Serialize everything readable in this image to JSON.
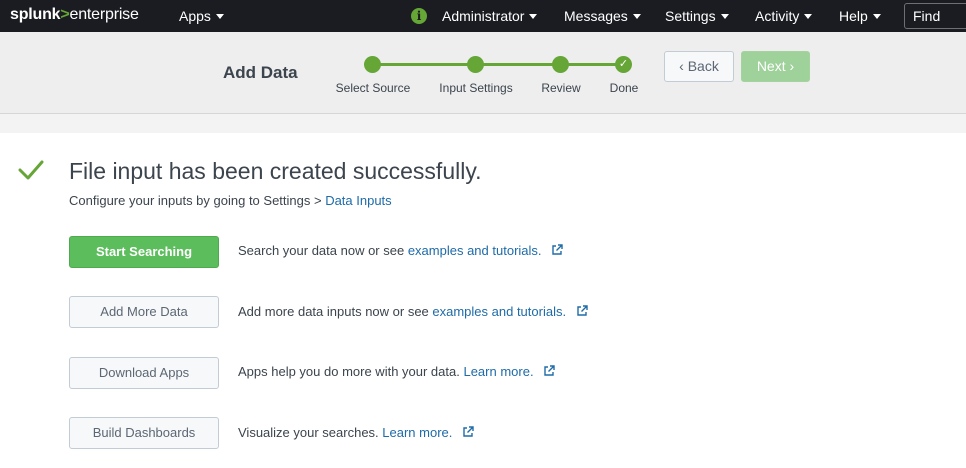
{
  "topbar": {
    "logo_part1": "splunk",
    "logo_gt": ">",
    "logo_part2": "enterprise",
    "apps": "Apps",
    "info_icon": "i",
    "administrator": "Administrator",
    "messages": "Messages",
    "settings": "Settings",
    "activity": "Activity",
    "help": "Help",
    "find_placeholder": "Find"
  },
  "wizard": {
    "title": "Add Data",
    "steps": [
      "Select Source",
      "Input Settings",
      "Review",
      "Done"
    ],
    "done_check": "✓",
    "back_label": "Back",
    "back_chevron": "‹",
    "next_label": "Next",
    "next_chevron": "›"
  },
  "content": {
    "headline": "File input has been created successfully.",
    "subline_text": "Configure your inputs by going to Settings > ",
    "subline_link": "Data Inputs",
    "rows": [
      {
        "button": "Start Searching",
        "text": "Search your data now or see ",
        "link": "examples and tutorials."
      },
      {
        "button": "Add More Data",
        "text": "Add more data inputs now or see ",
        "link": "examples and tutorials."
      },
      {
        "button": "Download Apps",
        "text": "Apps help you do more with your data. ",
        "link": "Learn more."
      },
      {
        "button": "Build Dashboards",
        "text": "Visualize your searches. ",
        "link": "Learn more."
      }
    ]
  },
  "colors": {
    "topbar_bg": "#1a1c21",
    "brand_green": "#65a637",
    "primary_button": "#5cbd5c",
    "link": "#1e6ba8"
  }
}
